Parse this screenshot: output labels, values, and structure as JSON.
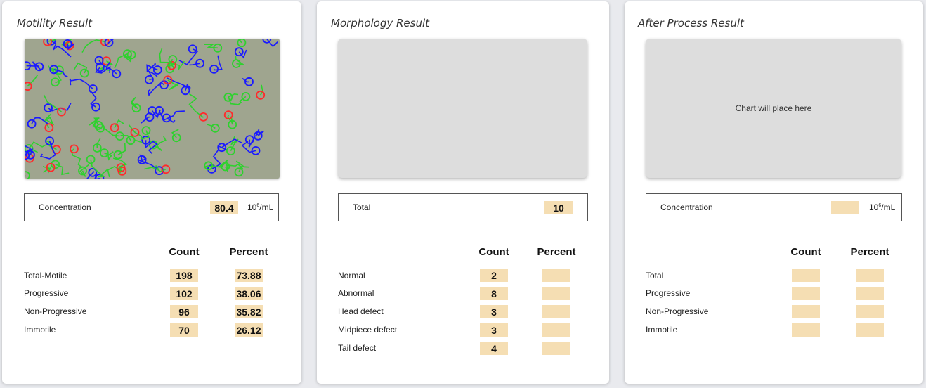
{
  "motility": {
    "title": "Motility Result",
    "concentration": {
      "label": "Concentration",
      "value": "80.4",
      "unit_base": "10",
      "unit_exp": "6",
      "unit_tail": "/mL"
    },
    "headers": {
      "count": "Count",
      "percent": "Percent"
    },
    "rows": [
      {
        "label": "Total-Motile",
        "count": "198",
        "percent": "73.88"
      },
      {
        "label": "Progressive",
        "count": "102",
        "percent": "38.06"
      },
      {
        "label": "Non-Progressive",
        "count": "96",
        "percent": "35.82"
      },
      {
        "label": "Immotile",
        "count": "70",
        "percent": "26.12"
      }
    ]
  },
  "morphology": {
    "title": "Morphology Result",
    "total": {
      "label": "Total",
      "value": "10"
    },
    "headers": {
      "count": "Count",
      "percent": "Percent"
    },
    "rows": [
      {
        "label": "Normal",
        "count": "2",
        "percent": ""
      },
      {
        "label": "Abnormal",
        "count": "8",
        "percent": ""
      },
      {
        "label": "Head defect",
        "count": "3",
        "percent": ""
      },
      {
        "label": "Midpiece defect",
        "count": "3",
        "percent": ""
      },
      {
        "label": "Tail defect",
        "count": "4",
        "percent": ""
      }
    ]
  },
  "after_process": {
    "title": "After Process Result",
    "chart_placeholder": "Chart will place here",
    "concentration": {
      "label": "Concentration",
      "value": "",
      "unit_base": "10",
      "unit_exp": "6",
      "unit_tail": "/mL"
    },
    "headers": {
      "count": "Count",
      "percent": "Percent"
    },
    "rows": [
      {
        "label": "Total",
        "count": "",
        "percent": ""
      },
      {
        "label": "Progressive",
        "count": "",
        "percent": ""
      },
      {
        "label": "Non-Progressive",
        "count": "",
        "percent": ""
      },
      {
        "label": "Immotile",
        "count": "",
        "percent": ""
      }
    ]
  },
  "colors": {
    "value_fill": "#f5deb3",
    "progressive": "#1a1aff",
    "non_progressive": "#2ed12e",
    "immotile": "#ff2a2a"
  }
}
